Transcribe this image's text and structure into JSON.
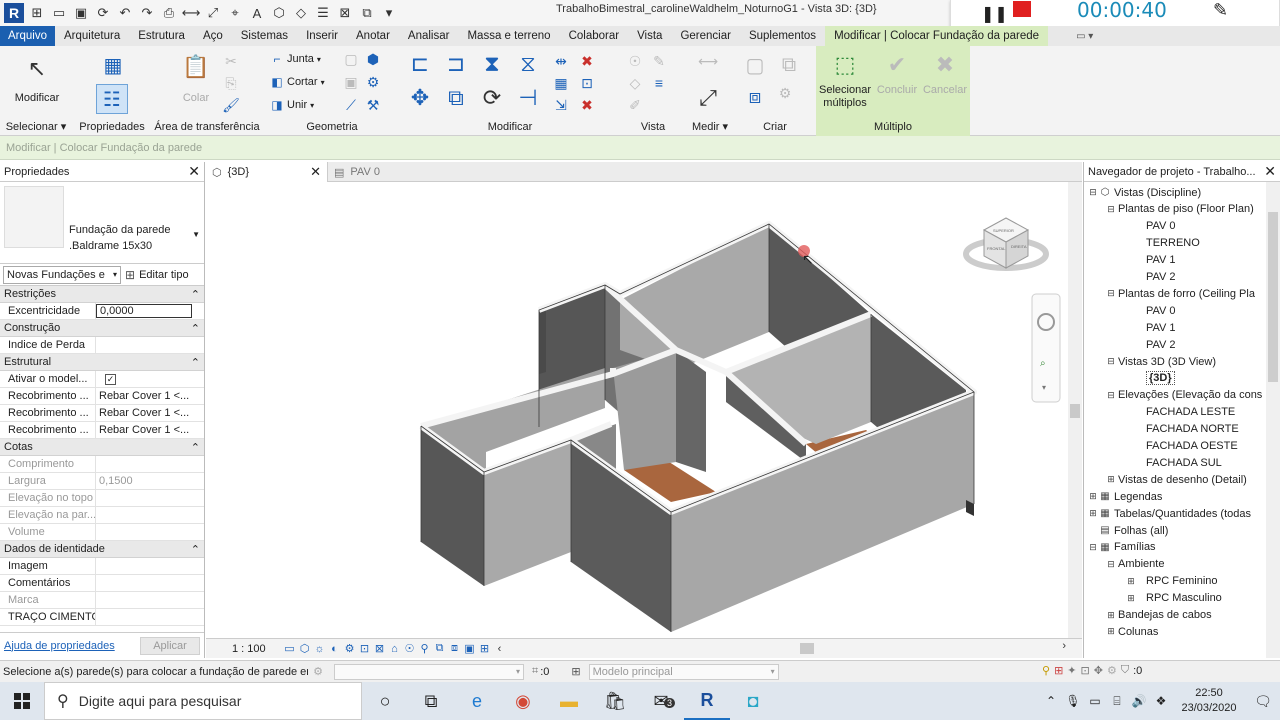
{
  "window": {
    "title": "TrabalhoBimestral_carolineWaldhelm_NoturnoG1 - Vista 3D: {3D}"
  },
  "recorder": {
    "time": "00:00:40"
  },
  "menu": {
    "tabs": [
      "Arquivo",
      "Arquitetura",
      "Estrutura",
      "Aço",
      "Sistemas",
      "Inserir",
      "Anotar",
      "Analisar",
      "Massa e terreno",
      "Colaborar",
      "Vista",
      "Gerenciar",
      "Suplementos",
      "Modificar | Colocar Fundação da parede"
    ]
  },
  "ribbon": {
    "modify_label": "Modificar",
    "paste_label": "Colar",
    "join_label": "Junta",
    "cut_label": "Cortar",
    "unite_label": "Unir",
    "select_multiple_label": "Selecionar múltiplos",
    "finish_label": "Concluir",
    "cancel_label": "Cancelar",
    "panels": {
      "select": "Selecionar",
      "properties": "Propriedades",
      "clipboard": "Área de transferência",
      "geometry": "Geometria",
      "modify": "Modificar",
      "view": "Vista",
      "measure": "Medir",
      "create": "Criar",
      "multiple": "Múltiplo"
    }
  },
  "options_bar": {
    "text": "Modificar | Colocar Fundação da parede"
  },
  "properties": {
    "header": "Propriedades",
    "type_name_line1": "Fundação da parede",
    "type_name_line2": ".Baldrame 15x30",
    "instance_selector": "Novas Fundações e",
    "edit_type": "Editar tipo",
    "groups": {
      "restricoes": "Restrições",
      "construcao": "Construção",
      "estrutural": "Estrutural",
      "cotas": "Cotas",
      "identidade": "Dados de identidade"
    },
    "rows": {
      "excentricidade": {
        "key": "Excentricidade",
        "value": "0,0000"
      },
      "indice_perda": {
        "key": "Indice de Perda",
        "value": ""
      },
      "ativar_modelo": {
        "key": "Ativar o model...",
        "value": "✓"
      },
      "recob1": {
        "key": "Recobrimento ...",
        "value": "Rebar Cover 1 <..."
      },
      "recob2": {
        "key": "Recobrimento ...",
        "value": "Rebar Cover 1 <..."
      },
      "recob3": {
        "key": "Recobrimento ...",
        "value": "Rebar Cover 1 <..."
      },
      "comprimento": {
        "key": "Comprimento",
        "value": ""
      },
      "largura": {
        "key": "Largura",
        "value": "0,1500"
      },
      "elev_topo": {
        "key": "Elevação no topo",
        "value": ""
      },
      "elev_par": {
        "key": "Elevação na par...",
        "value": ""
      },
      "volume": {
        "key": "Volume",
        "value": ""
      },
      "imagem": {
        "key": "Imagem",
        "value": ""
      },
      "comentarios": {
        "key": "Comentários",
        "value": ""
      },
      "marca": {
        "key": "Marca",
        "value": ""
      },
      "traco": {
        "key": "TRAÇO CIMENTO",
        "value": ""
      }
    },
    "help_link": "Ajuda de propriedades",
    "apply": "Aplicar"
  },
  "view": {
    "active_tab": "{3D}",
    "inactive_tab": "PAV 0",
    "scale": "1 : 100",
    "viewcube_faces": [
      "SUPERIOR",
      "FRONTAL",
      "DIREITA"
    ]
  },
  "browser": {
    "header": "Navegador de projeto - Trabalho...",
    "items": [
      "Vistas (Discipline)",
      "Plantas de piso (Floor Plan)",
      "PAV 0",
      "TERRENO",
      "PAV 1",
      "PAV 2",
      "Plantas de forro (Ceiling Pla",
      "PAV 0",
      "PAV 1",
      "PAV 2",
      "Vistas 3D (3D View)",
      "{3D}",
      "Elevações (Elevação da cons",
      "FACHADA LESTE",
      "FACHADA NORTE",
      "FACHADA OESTE",
      "FACHADA SUL",
      "Vistas de desenho (Detail)",
      "Legendas",
      "Tabelas/Quantidades (todas",
      "Folhas (all)",
      "Famílias",
      "Ambiente",
      "RPC Feminino",
      "RPC Masculino",
      "Bandejas de cabos",
      "Colunas"
    ]
  },
  "status_bar": {
    "text": "Selecione a(s) parede(s) para colocar a fundação de parede er",
    "count": ":0",
    "model": "Modelo principal",
    "filter_count": ":0"
  },
  "taskbar": {
    "search_placeholder": "Digite aqui para pesquisar",
    "mail_badge": "3",
    "time": "22:50",
    "date": "23/03/2020"
  },
  "colors": {
    "file_tab": "#1b5fb0",
    "context_tab": "#d8ecbf",
    "wall_top": "#f2f2f2",
    "wall_light": "#a9a9a9",
    "wall_dark": "#5a5a5a",
    "floor": "#a9663e"
  }
}
